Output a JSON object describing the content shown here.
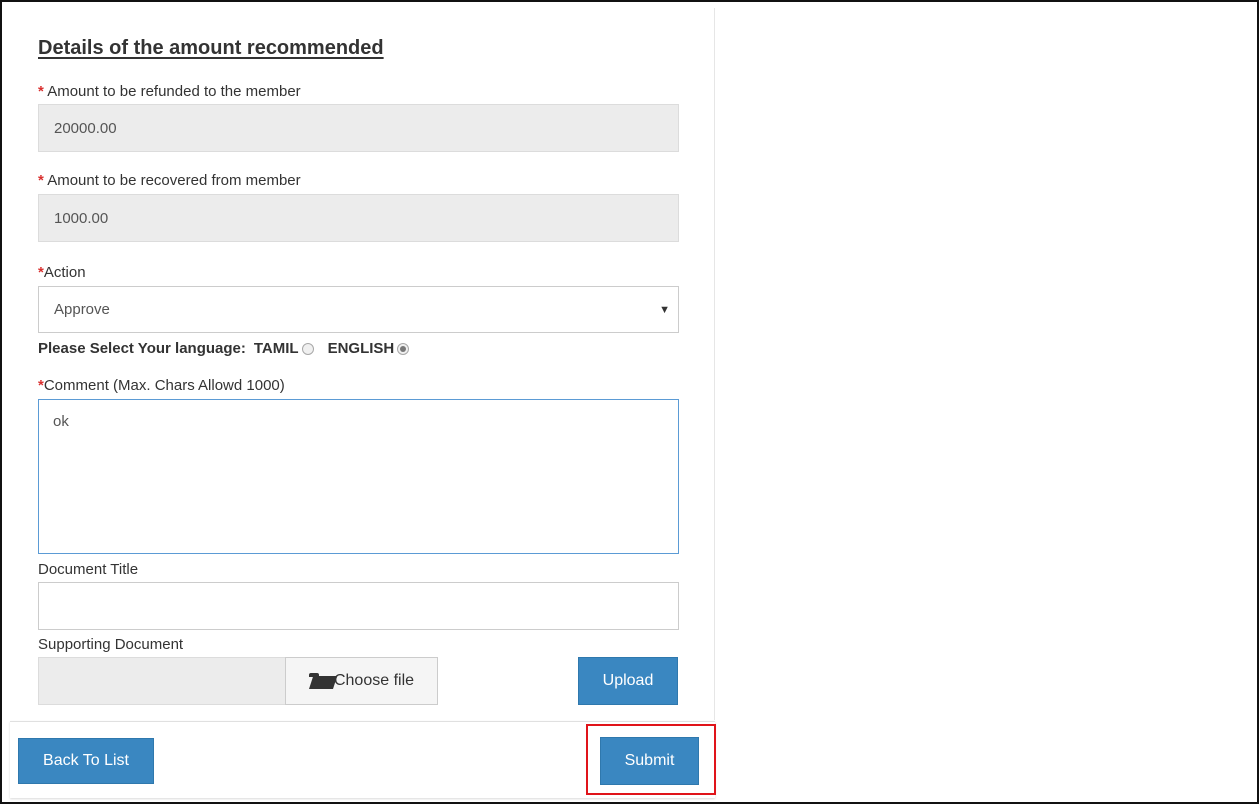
{
  "section": {
    "heading": "Details of the amount recommended"
  },
  "form": {
    "required_mark": "*",
    "refund": {
      "label": "Amount to be refunded to the member",
      "value": "20000.00"
    },
    "recover": {
      "label": "Amount to be recovered from member",
      "value": "1000.00"
    },
    "action": {
      "label": "Action",
      "selected": "Approve"
    },
    "language": {
      "prompt": "Please Select Your language:",
      "options": [
        "TAMIL",
        "ENGLISH"
      ],
      "selected": "ENGLISH"
    },
    "comment": {
      "label": "Comment (Max. Chars Allowd 1000)",
      "value": "ok"
    },
    "document_title": {
      "label": "Document Title",
      "value": ""
    },
    "supporting_document": {
      "label": "Supporting Document",
      "choose_label": "Choose file",
      "upload_label": "Upload"
    }
  },
  "footer": {
    "back_label": "Back To List",
    "submit_label": "Submit"
  },
  "colors": {
    "primary_button": "#3a87c1",
    "required": "#d9302f",
    "highlight": "#e0141a"
  },
  "icons": {
    "choose_file": "folder-open-icon",
    "select_arrow": "caret-down-icon"
  }
}
